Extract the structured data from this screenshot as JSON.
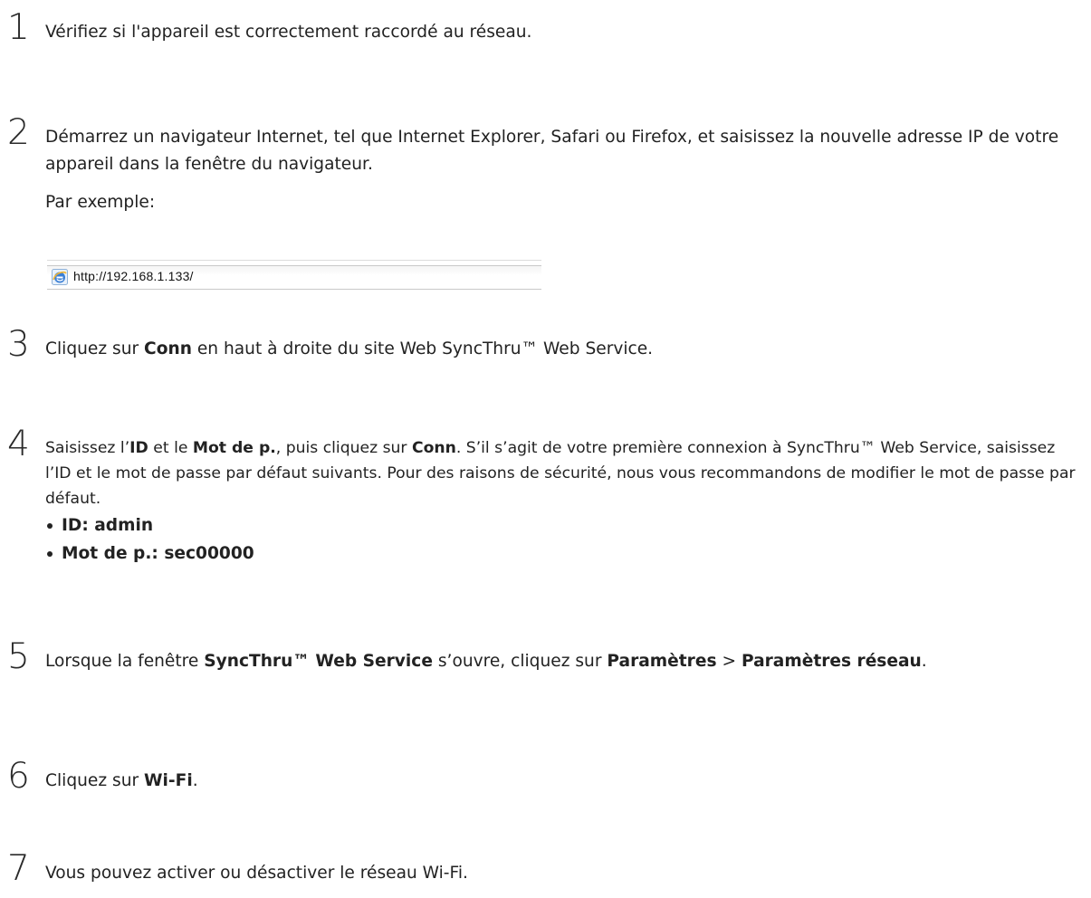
{
  "steps": [
    {
      "num": "1",
      "text": "Vérifiez si l'appareil est correctement raccordé au réseau."
    },
    {
      "num": "2",
      "text": "Démarrez un navigateur Internet, tel que Internet Explorer, Safari ou Firefox, et saisissez la nouvelle adresse IP de votre appareil dans la fenêtre du navigateur.",
      "example_label": "Par exemple:",
      "example_url": "http://192.168.1.133/"
    },
    {
      "num": "3",
      "pre": "Cliquez sur ",
      "bold": "Conn",
      "post": " en haut à droite du site Web SyncThru™ Web Service."
    },
    {
      "num": "4",
      "pre1": "Saisissez l’",
      "bold1": "ID",
      "mid1": " et le ",
      "bold2": "Mot de p.",
      "mid2": ", puis cliquez sur ",
      "bold3": "Conn",
      "post": ". S’il s’agit de votre première connexion à SyncThru™ Web Service, saisissez l’ID et le mot de passe par défaut suivants. Pour des raisons de sécurité, nous vous recommandons de modifier le mot de passe par défaut.",
      "bullets": [
        "ID: admin",
        "Mot de p.: sec00000"
      ]
    },
    {
      "num": "5",
      "pre": "Lorsque la fenêtre ",
      "bold1": "SyncThru™ Web Service",
      "mid": " s’ouvre, cliquez sur ",
      "bold2": "Paramètres",
      "sep": " > ",
      "bold3": "Paramètres réseau",
      "post": "."
    },
    {
      "num": "6",
      "pre": "Cliquez sur ",
      "bold": "Wi-Fi",
      "post": "."
    },
    {
      "num": "7",
      "text": "Vous pouvez activer ou désactiver le réseau Wi-Fi."
    }
  ],
  "icons": {
    "browser": "internet-explorer-icon",
    "accent": "#3a7fd5"
  }
}
